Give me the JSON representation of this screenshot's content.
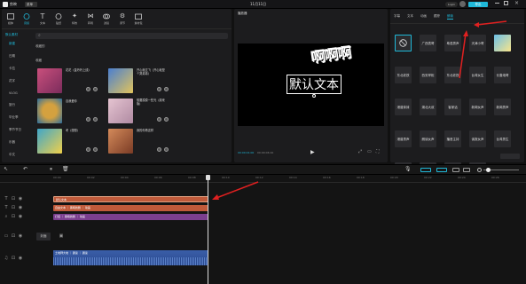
{
  "app": {
    "name": "剪映",
    "menu": "菜单",
    "time_title": "11月11日",
    "upgrade": "Luyin",
    "export": "导出"
  },
  "toolbar": {
    "items": [
      "媒体",
      "音频",
      "文本",
      "贴纸",
      "特效",
      "转场",
      "滤镜",
      "调节",
      "素材包"
    ]
  },
  "left_nav": {
    "section": "默认素材",
    "items": [
      "新建",
      "日期",
      "卡拉",
      "花字",
      "VLOG",
      "旅行",
      "毕业季",
      "季节节日",
      "乐器",
      "中文"
    ]
  },
  "library": {
    "header": "收藏的",
    "subtitle": "收藏",
    "sort": "筛选"
  },
  "templates": [
    {
      "title": "花花（金玲玲上线）",
      "sub": "作者",
      "color1": "#c94f7c",
      "color2": "#7b2c5c"
    },
    {
      "title": "开心就过飞（开心就是个哭弟弟）",
      "sub": "作者",
      "color1": "#4a7fd0",
      "color2": "#e2c45b"
    },
    {
      "title": "自我爱你",
      "sub": "",
      "color1": "#2c6e9e",
      "color2": "#d4a13f"
    },
    {
      "title": "想要摸摸一些光（原来版）",
      "sub": "",
      "color1": "#e5c4d1",
      "color2": "#b08aa2"
    },
    {
      "title": "考（想想）",
      "sub": "作者",
      "color1": "#3fa6c9",
      "color2": "#f0d04a"
    },
    {
      "title": "我的你再这样",
      "sub": "作者",
      "color1": "#d48a5a",
      "color2": "#7a3b25"
    }
  ],
  "player": {
    "title": "播放器",
    "text_main": "默认文本",
    "text_art": "啊啊啊",
    "time_current": "00:00:01:00",
    "time_total": "00:00:06:10"
  },
  "right_panel": {
    "tabs": [
      "字幕",
      "文本",
      "动画",
      "跟踪",
      "朗读"
    ],
    "active_tab": "朗读",
    "voices": [
      "广西表哥",
      "粤语男声",
      "天津小哥",
      "",
      "东北老铁",
      "西安掌柜",
      "东北老铁",
      "台湾女生",
      "长春炮哥",
      "港普妹妹",
      "湖北大叔",
      "客家话",
      "新闻女声",
      "新闻男声",
      "港普男声",
      "朗读女声",
      "播音主持",
      "读报女声",
      "台湾男生",
      "港普女声",
      "萌娃女声",
      "播音女声",
      "东北老铁"
    ]
  },
  "timeline": {
    "ruler": [
      "00:00",
      "00:02",
      "00:04",
      "00:06",
      "00:08",
      "00:10",
      "00:12",
      "00:14",
      "00:16",
      "00:18",
      "00:20",
      "00:22",
      "00:24",
      "00:26",
      "00:28"
    ],
    "clip_text": "默认文本",
    "clip_sub1": "自由文本 ｜ 黑暗舞剧 ｜ 动画",
    "clip_sub2": "打招 ｜ 黑暗舞剧 ｜ 动画",
    "cover_label": "封面",
    "audio_label": "土地拜大地 ｜ 朗读 ｜ 朗读"
  },
  "colors": {
    "accent": "#1fb8d8",
    "text_clip": "#c05a3a",
    "sub_clip": "#7b3f8f",
    "audio_clip": "#3a5ea8"
  }
}
